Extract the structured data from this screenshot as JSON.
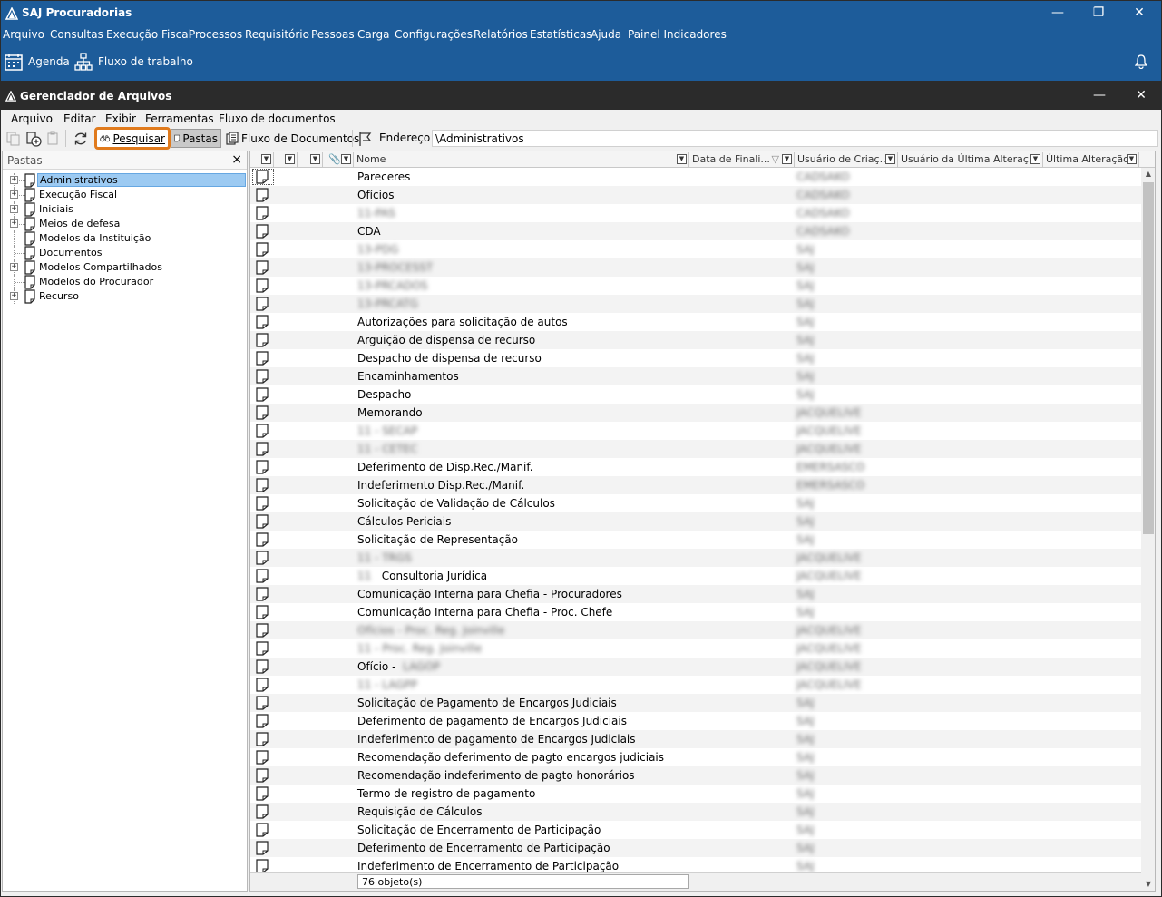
{
  "app": {
    "title": "SAJ Procuradorias",
    "menu": [
      "Arquivo",
      "Consultas",
      "Execução Fiscal",
      "Processos",
      "Requisitório",
      "Pessoas",
      "Carga",
      "Configurações",
      "Relatórios",
      "Estatísticas",
      "Ajuda",
      "Painel Indicadores"
    ],
    "toolbar": {
      "agenda": "Agenda",
      "workflow": "Fluxo de trabalho"
    }
  },
  "window": {
    "title": "Gerenciador de Arquivos",
    "menu": [
      "Arquivo",
      "Editar",
      "Exibir",
      "Ferramentas",
      "Fluxo de documentos"
    ],
    "toolbar": {
      "search": "Pesquisar",
      "folders": "Pastas",
      "document_flow": "Fluxo de Documentos",
      "address_label": "Endereço",
      "address_value": "\\Administrativos"
    }
  },
  "folders": {
    "title": "Pastas",
    "close": "×",
    "items": [
      {
        "label": "Administrativos",
        "expandable": true,
        "selected": true
      },
      {
        "label": "Execução Fiscal",
        "expandable": true
      },
      {
        "label": "Iniciais",
        "expandable": true
      },
      {
        "label": "Meios de defesa",
        "expandable": true
      },
      {
        "label": "Modelos da Instituição",
        "expandable": false
      },
      {
        "label": "Documentos",
        "expandable": false
      },
      {
        "label": "Modelos Compartilhados",
        "expandable": true
      },
      {
        "label": "Modelos do Procurador",
        "expandable": false
      },
      {
        "label": "Recurso",
        "expandable": true
      }
    ]
  },
  "grid": {
    "columns": [
      "Nome",
      "Data de Finali...",
      "Usuário de Criaç...",
      "Usuário da Última Alteraç...",
      "Última Alteração"
    ],
    "rows": [
      {
        "name": "Pareceres",
        "user": "CADSAKO",
        "blur": false
      },
      {
        "name": "Ofícios",
        "user": "CADSAKO",
        "blur": false
      },
      {
        "name": "11-PAS",
        "user": "CADSAKO",
        "blur": true
      },
      {
        "name": "CDA",
        "user": "CADSAKO",
        "blur": false
      },
      {
        "name": "13-PDG",
        "user": "SAJ",
        "blur": true
      },
      {
        "name": "13-PROCESST",
        "user": "SAJ",
        "blur": true
      },
      {
        "name": "13-PRCADOS",
        "user": "SAJ",
        "blur": true
      },
      {
        "name": "13-PRCATG",
        "user": "SAJ",
        "blur": true
      },
      {
        "name": "Autorizações para solicitação de autos",
        "user": "SAJ",
        "blur": false
      },
      {
        "name": "Arguição de dispensa de recurso",
        "user": "SAJ",
        "blur": false
      },
      {
        "name": "Despacho de dispensa de recurso",
        "user": "SAJ",
        "blur": false
      },
      {
        "name": "Encaminhamentos",
        "user": "SAJ",
        "blur": false
      },
      {
        "name": "Despacho",
        "user": "SAJ",
        "blur": false
      },
      {
        "name": "Memorando",
        "user": "JACQUELIVE",
        "blur": false
      },
      {
        "name": "11 - SECAP",
        "user": "JACQUELIVE",
        "blur": true
      },
      {
        "name": "11 - CETEC",
        "user": "JACQUELIVE",
        "blur": true
      },
      {
        "name": "Deferimento de Disp.Rec./Manif.",
        "user": "EMERSASCO",
        "blur": false
      },
      {
        "name": "Indeferimento Disp.Rec./Manif.",
        "user": "EMERSASCO",
        "blur": false
      },
      {
        "name": "Solicitação de Validação de Cálculos",
        "user": "SAJ",
        "blur": false
      },
      {
        "name": "Cálculos Periciais",
        "user": "SAJ",
        "blur": false
      },
      {
        "name": "Solicitação de Representação",
        "user": "SAJ",
        "blur": false
      },
      {
        "name": "11 - TRGS",
        "user": "JACQUELIVE",
        "blur": true
      },
      {
        "name": "Consultoria Jurídica",
        "prefix": "11",
        "user": "JACQUELIVE",
        "blur": false
      },
      {
        "name": "Comunicação Interna para Chefia - Procuradores",
        "user": "SAJ",
        "blur": false
      },
      {
        "name": "Comunicação Interna para Chefia - Proc. Chefe",
        "user": "SAJ",
        "blur": false
      },
      {
        "name": "Ofícios - Proc. Reg. Joinville",
        "user": "JACQUELIVE",
        "blur": true
      },
      {
        "name": "11 - Proc. Reg. Joinville",
        "user": "JACQUELIVE",
        "blur": true
      },
      {
        "name": "Ofício -",
        "suffix": "LAGOP",
        "user": "JACQUELIVE",
        "blur": false
      },
      {
        "name": "11 - LAGPP",
        "user": "JACQUELIVE",
        "blur": true
      },
      {
        "name": "Solicitação de Pagamento de Encargos Judiciais",
        "user": "SAJ",
        "blur": false
      },
      {
        "name": "Deferimento de pagamento de Encargos Judiciais",
        "user": "SAJ",
        "blur": false
      },
      {
        "name": "Indeferimento de pagamento de Encargos Judiciais",
        "user": "SAJ",
        "blur": false
      },
      {
        "name": "Recomendação deferimento de pagto encargos judiciais",
        "user": "SAJ",
        "blur": false
      },
      {
        "name": "Recomendação indeferimento de pagto honorários",
        "user": "SAJ",
        "blur": false
      },
      {
        "name": "Termo de registro de pagamento",
        "user": "SAJ",
        "blur": false
      },
      {
        "name": "Requisição de Cálculos",
        "user": "SAJ",
        "blur": false
      },
      {
        "name": "Solicitação de Encerramento de Participação",
        "user": "SAJ",
        "blur": false
      },
      {
        "name": "Deferimento de Encerramento de Participação",
        "user": "SAJ",
        "blur": false
      },
      {
        "name": "Indeferimento de Encerramento de Participação",
        "user": "SAJ",
        "blur": false
      }
    ],
    "status": "76 objeto(s)"
  },
  "colors": {
    "app_blue": "#1d5c9a",
    "window_dark": "#2b2b2b",
    "highlight_orange": "#e07a1c",
    "selection": "#9ccaf2"
  }
}
